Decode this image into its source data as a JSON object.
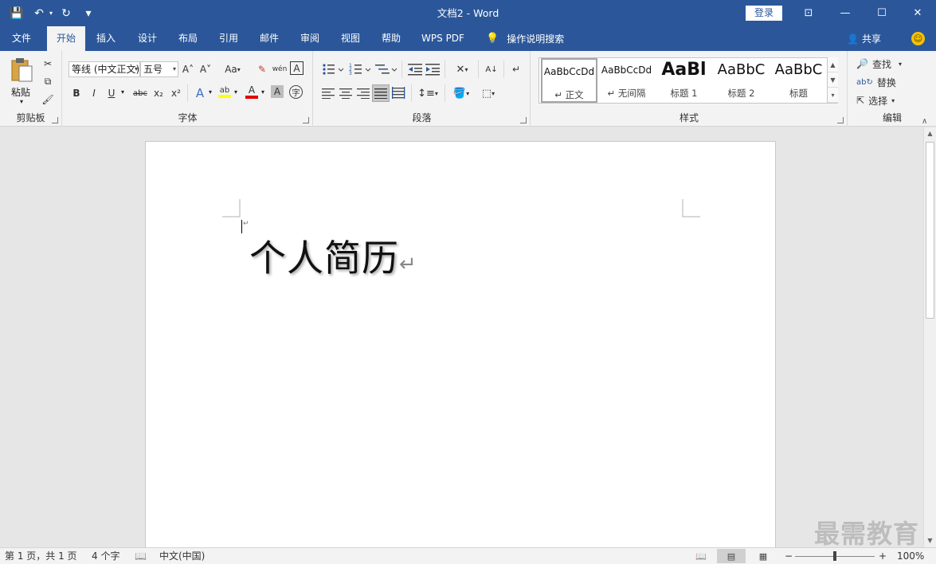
{
  "titlebar": {
    "title": "文档2 - Word",
    "login": "登录",
    "qat": {
      "save": "💾",
      "undo": "↶",
      "redo": "↻",
      "customize": "▾"
    },
    "controls": {
      "ribbon_options": "⊡",
      "minimize": "—",
      "restore": "☐",
      "close": "✕"
    }
  },
  "tabs": [
    "文件",
    "开始",
    "插入",
    "设计",
    "布局",
    "引用",
    "邮件",
    "审阅",
    "视图",
    "帮助",
    "WPS PDF"
  ],
  "active_tab": "开始",
  "tell_me": "操作说明搜索",
  "share": "共享",
  "smiley": "☺",
  "ribbon": {
    "clipboard": {
      "label": "剪贴板",
      "paste": "粘贴",
      "paste_caret": "▾",
      "cut": "✂",
      "copy": "⧉",
      "format_painter": "🖌"
    },
    "font": {
      "label": "字体",
      "font_name": "等线 (中文正文)",
      "font_size": "五号",
      "grow": "A˄",
      "shrink": "A˅",
      "change_case": "Aa",
      "clear_format": "✎",
      "phonetic": "wén",
      "char_border": "A",
      "bold": "B",
      "italic": "I",
      "underline": "U",
      "strike": "abc",
      "subscript": "x₂",
      "superscript": "x²",
      "text_effects": "A",
      "highlight": "ab",
      "font_color": "A",
      "char_shading": "A",
      "enclose": "字"
    },
    "paragraph": {
      "label": "段落",
      "sort": "A↓",
      "show_marks": "↵"
    },
    "styles": {
      "label": "样式",
      "items": [
        {
          "sample": "AaBbCcDd",
          "name": "↵ 正文"
        },
        {
          "sample": "AaBbCcDd",
          "name": "↵ 无间隔"
        },
        {
          "sample": "AaBl",
          "name": "标题 1"
        },
        {
          "sample": "AaBbC",
          "name": "标题 2"
        },
        {
          "sample": "AaBbC",
          "name": "标题"
        }
      ],
      "scroll_up": "▲",
      "scroll_down": "▼",
      "more": "▾"
    },
    "editing": {
      "label": "编辑",
      "find": "查找",
      "replace": "替换",
      "select": "选择"
    }
  },
  "document": {
    "heading": "个人简历",
    "para_mark": "↵",
    "watermark": "最需教育"
  },
  "status": {
    "page": "第 1 页，共 1 页",
    "words": "4 个字",
    "language": "中文(中国)",
    "zoom": "100%",
    "zoom_minus": "−",
    "zoom_plus": "+"
  },
  "colors": {
    "accent": "#2b579a",
    "highlight": "#ffff00",
    "font_color": "#e00000"
  }
}
